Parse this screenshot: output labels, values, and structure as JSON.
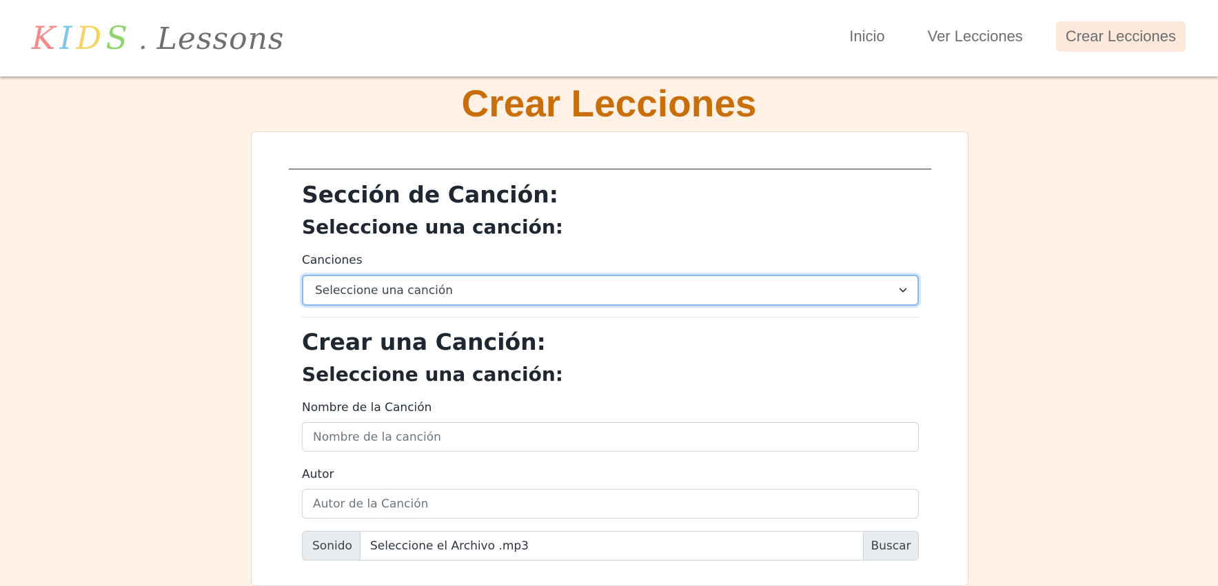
{
  "logo": {
    "kids_letters": [
      "K",
      "I",
      "D",
      "S"
    ],
    "kids_colors": [
      "#f58a8a",
      "#7ec9e8",
      "#f2d565",
      "#8fd46a"
    ],
    "dot": ".",
    "lessons": "Lessons"
  },
  "nav": {
    "items": [
      {
        "label": "Inicio",
        "active": false
      },
      {
        "label": "Ver Lecciones",
        "active": false
      },
      {
        "label": "Crear Lecciones",
        "active": true
      }
    ]
  },
  "page": {
    "title": "Crear Lecciones"
  },
  "song_section": {
    "heading": "Sección de Canción:",
    "subheading": "Seleccione una canción:",
    "select_label": "Canciones",
    "select_value": "Seleccione una canción"
  },
  "create_section": {
    "heading": "Crear una Canción:",
    "subheading": "Seleccione una canción:",
    "name_label": "Nombre de la Canción",
    "name_placeholder": "Nombre de la canción",
    "author_label": "Autor",
    "author_placeholder": "Autor de la Canción",
    "file_addon": "Sonido",
    "file_text": "Seleccione el Archivo .mp3",
    "file_button": "Buscar"
  },
  "colors": {
    "background": "#fff1e6",
    "title": "#c86f0b",
    "active_nav_bg": "#fde9db",
    "select_focus": "#8ab7ee"
  },
  "icons": {
    "select_arrow": "chevron-down-icon"
  }
}
